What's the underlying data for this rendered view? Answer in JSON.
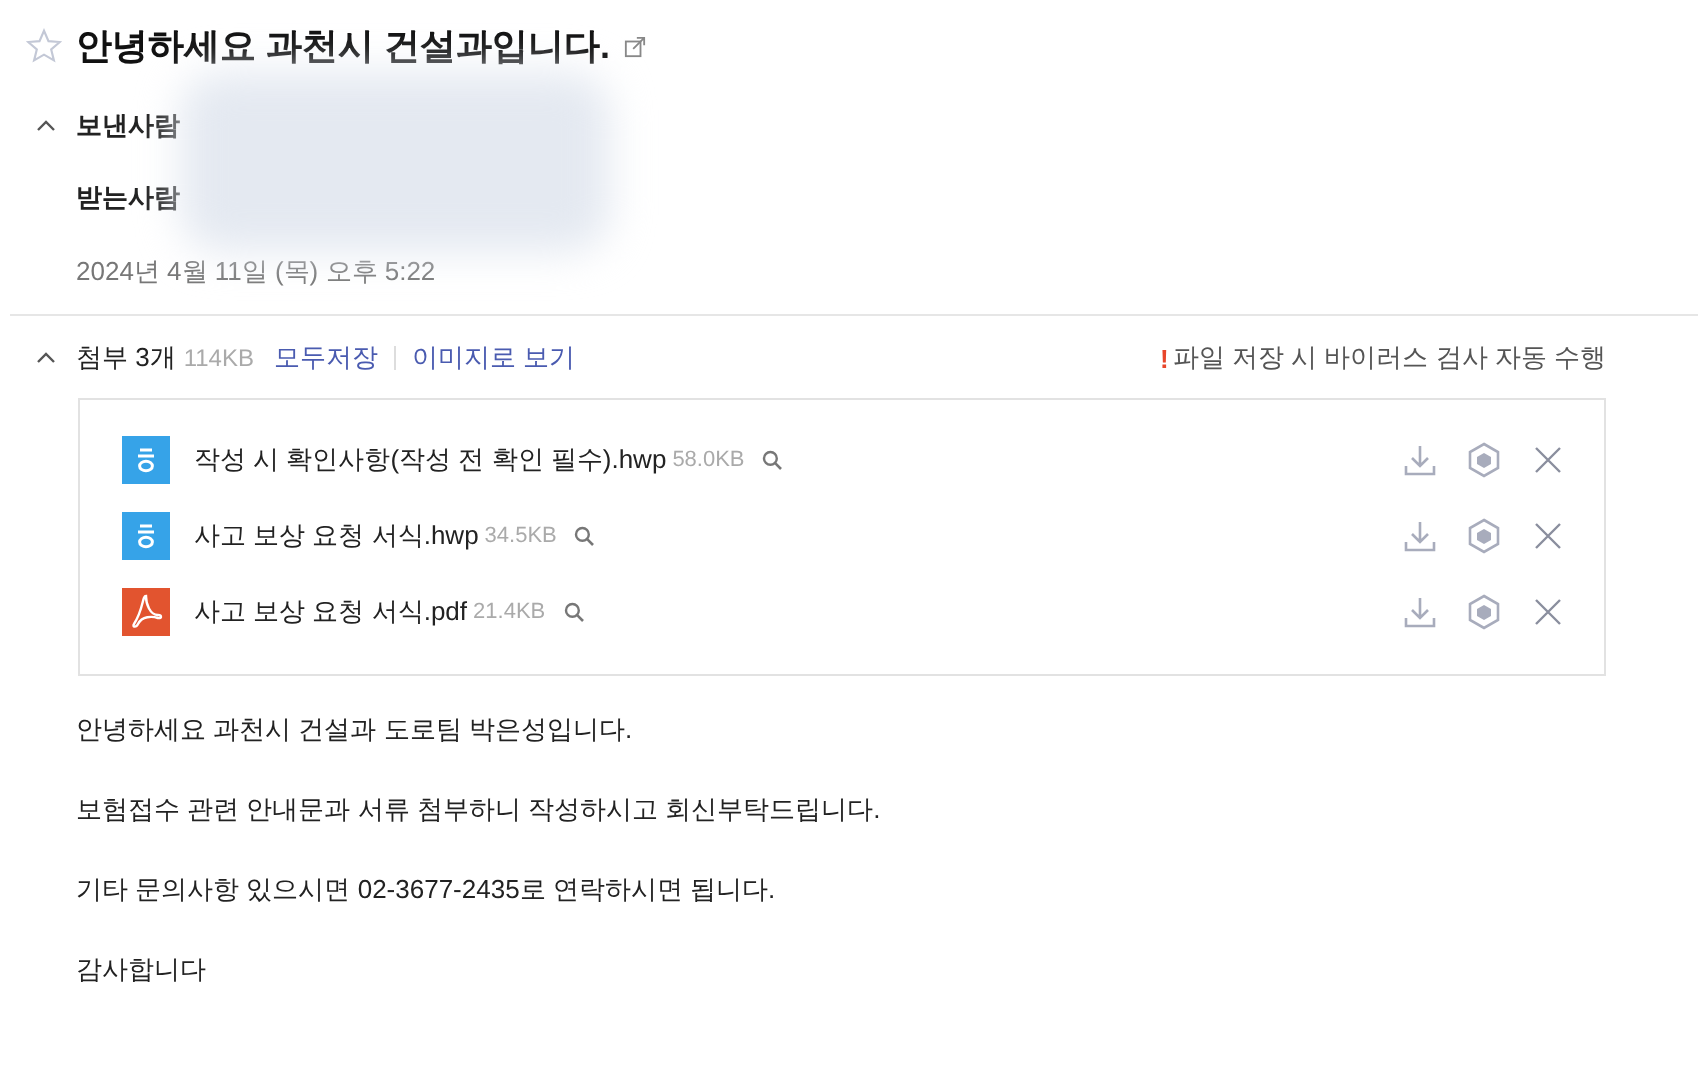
{
  "subject": {
    "title": "안녕하세요 과천시 건설과입니다.",
    "starred": false
  },
  "header": {
    "expanded": true,
    "sender_label": "보낸사람",
    "recipient_label": "받는사람",
    "date": "2024년 4월 11일 (목) 오후 5:22"
  },
  "attachments": {
    "expanded": true,
    "label": "첨부 3개",
    "total_size": "114KB",
    "save_all": "모두저장",
    "view_as_image": "이미지로 보기",
    "notice_mark": "!",
    "notice": "파일 저장 시 바이러스 검사 자동 수행",
    "files": [
      {
        "kind": "hwp",
        "name": "작성 시 확인사항(작성 전 확인 필수).hwp",
        "size": "58.0KB"
      },
      {
        "kind": "hwp",
        "name": "사고 보상 요청 서식.hwp",
        "size": "34.5KB"
      },
      {
        "kind": "pdf",
        "name": "사고 보상 요청 서식.pdf",
        "size": "21.4KB"
      }
    ]
  },
  "body": [
    "안녕하세요 과천시 건설과 도로팀 박은성입니다.",
    "보험접수 관련 안내문과 서류 첨부하니 작성하시고 회신부탁드립니다.",
    "기타 문의사항 있으시면 02-3677-2435로 연락하시면 됩니다.",
    "감사합니다"
  ]
}
